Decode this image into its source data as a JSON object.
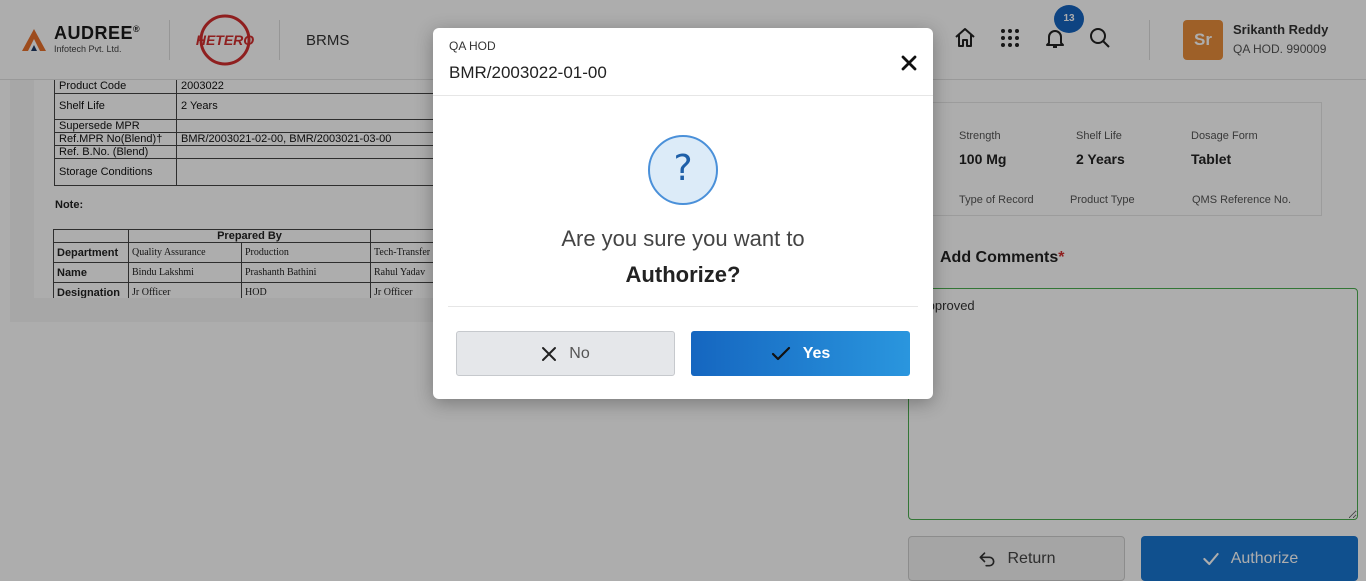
{
  "header": {
    "brand_name": "AUDREE",
    "brand_reg": "®",
    "brand_sub": "Infotech Pvt. Ltd.",
    "client_logo": "HETERO",
    "app_name": "BRMS",
    "notification_count": "13",
    "icons": [
      "home-icon",
      "apps-grid-icon",
      "bell-icon",
      "search-icon"
    ],
    "user": {
      "initials": "Sr",
      "name": "Srikanth Reddy",
      "role": "QA HOD. 990009"
    }
  },
  "document": {
    "spec_rows": [
      {
        "label": "Product Code",
        "value": "2003022"
      },
      {
        "label": "Shelf Life",
        "value": "2 Years"
      },
      {
        "label": "Supersede MPR",
        "value": ""
      },
      {
        "label": "Ref.MPR No(Blend)†",
        "value": "BMR/2003021-02-00, BMR/2003021-03-00"
      },
      {
        "label": "Ref. B.No. (Blend)",
        "value": ""
      },
      {
        "label": "Storage Conditions",
        "value": ""
      }
    ],
    "note_label": "Note:",
    "prepared_by": "Prepared By",
    "prep_rows": [
      {
        "label": "Department",
        "c1": "Quality Assurance",
        "c2": "Production",
        "c3": "Tech-Transfer"
      },
      {
        "label": "Name",
        "c1": "Bindu  Lakshmi",
        "c2": "Prashanth  Bathini",
        "c3": "Rahul  Yadav"
      },
      {
        "label": "Designation",
        "c1": "Jr Officer",
        "c2": "HOD",
        "c3": "Jr Officer"
      }
    ]
  },
  "details": {
    "strength_label": "Strength",
    "strength_value": "100 Mg",
    "shelf_life_label": "Shelf Life",
    "shelf_life_value": "2 Years",
    "dosage_form_label": "Dosage Form",
    "dosage_form_value": "Tablet",
    "type_of_record_label": "Type of Record",
    "product_type_label": "Product Type",
    "qms_ref_label": "QMS Reference No."
  },
  "comments": {
    "label": "Add Comments",
    "required_mark": "*",
    "value": "Approved"
  },
  "actions": {
    "return_label": "Return",
    "authorize_label": "Authorize"
  },
  "modal": {
    "role": "QA HOD",
    "title": "BMR/2003022-01-00",
    "question_icon": "?",
    "message": "Are you sure you want to",
    "action": "Authorize?",
    "no_label": "No",
    "yes_label": "Yes"
  },
  "colors": {
    "primary": "#1976d2",
    "badge": "#1565c0",
    "avatar": "#e98e3c",
    "required": "#d32f2f",
    "comments_border": "#4caf50"
  }
}
